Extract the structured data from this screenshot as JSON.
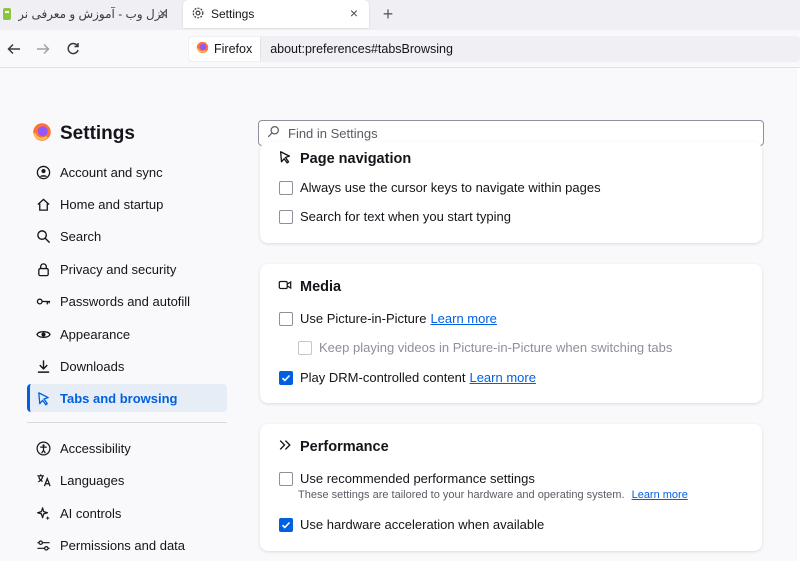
{
  "tabs": [
    {
      "title": "انزل وب - آموزش و معرفی نرم افزار",
      "active": false
    },
    {
      "title": "Settings",
      "active": true
    }
  ],
  "urlbar": {
    "identity_label": "Firefox",
    "url": "about:preferences#tabsBrowsing"
  },
  "sidebar": {
    "title": "Settings",
    "items": [
      {
        "label": "Account and sync",
        "icon": "account-icon"
      },
      {
        "label": "Home and startup",
        "icon": "home-icon"
      },
      {
        "label": "Search",
        "icon": "search-icon"
      },
      {
        "label": "Privacy and security",
        "icon": "lock-icon"
      },
      {
        "label": "Passwords and autofill",
        "icon": "key-icon"
      },
      {
        "label": "Appearance",
        "icon": "eye-icon"
      },
      {
        "label": "Downloads",
        "icon": "download-icon"
      },
      {
        "label": "Tabs and browsing",
        "icon": "pointer-icon",
        "selected": true
      },
      {
        "label": "Accessibility",
        "icon": "accessibility-icon"
      },
      {
        "label": "Languages",
        "icon": "translate-icon"
      },
      {
        "label": "AI controls",
        "icon": "sparkle-icon"
      },
      {
        "label": "Permissions and data",
        "icon": "sliders-icon"
      }
    ]
  },
  "search": {
    "placeholder": "Find in Settings"
  },
  "sections": {
    "page_navigation": {
      "title": "Page navigation",
      "options": [
        {
          "label": "Always use the cursor keys to navigate within pages",
          "checked": false
        },
        {
          "label": "Search for text when you start typing",
          "checked": false
        }
      ]
    },
    "media": {
      "title": "Media",
      "pip": {
        "label": "Use Picture-in-Picture",
        "link": "Learn more",
        "checked": false
      },
      "keep_playing": {
        "label": "Keep playing videos in Picture-in-Picture when switching tabs",
        "checked": false,
        "disabled": true
      },
      "drm": {
        "label": "Play DRM-controlled content",
        "link": "Learn more",
        "checked": true
      }
    },
    "performance": {
      "title": "Performance",
      "recommended": {
        "label": "Use recommended performance settings",
        "checked": false
      },
      "description": "These settings are tailored to your hardware and operating system.",
      "description_link": "Learn more",
      "hw_accel": {
        "label": "Use hardware acceleration when available",
        "checked": true
      }
    }
  },
  "colors": {
    "accent": "#0061e0",
    "selected_bg": "#e7edf6"
  }
}
